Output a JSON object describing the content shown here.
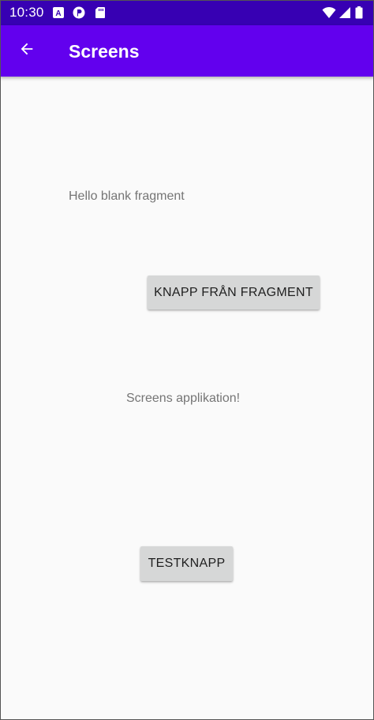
{
  "status_bar": {
    "time": "10:30",
    "left_icons": [
      "a-box-icon",
      "pinterest-icon",
      "sd-card-icon"
    ],
    "right_icons": [
      "wifi-icon",
      "cell-signal-icon",
      "battery-icon"
    ]
  },
  "app_bar": {
    "title": "Screens",
    "back_icon": "arrow-back-icon"
  },
  "content": {
    "fragment_text": "Hello blank fragment",
    "fragment_button": "KNAPP FRÅN FRAGMENT",
    "main_text": "Screens applikation!",
    "test_button": "TESTKNAPP"
  },
  "colors": {
    "status_bar": "#3700b3",
    "app_bar": "#6200ee",
    "background": "#fafafa",
    "button": "#d6d7d7"
  }
}
